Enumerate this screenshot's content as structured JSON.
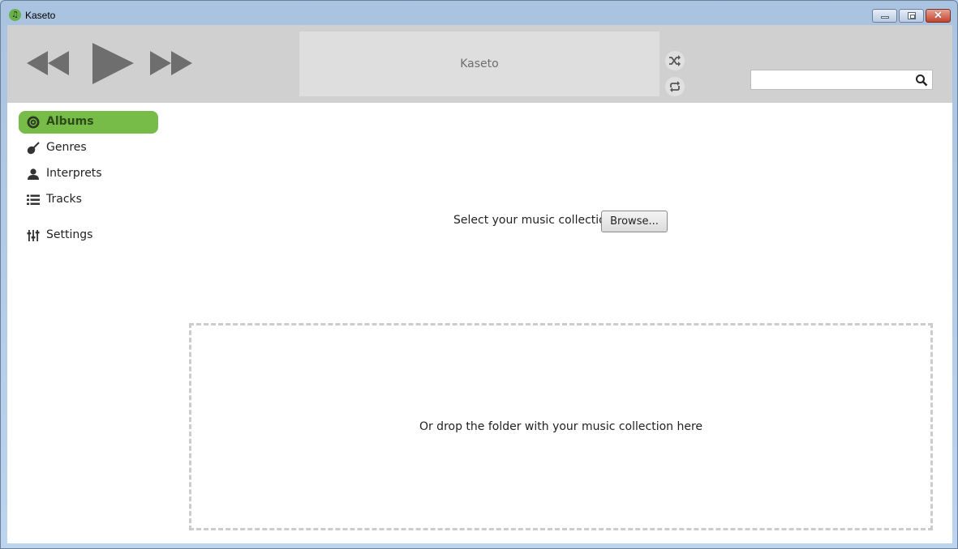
{
  "window": {
    "title": "Kaseto",
    "app_icon": "music-note-icon",
    "controls": {
      "minimize": "minimize-icon",
      "maximize": "restore-icon",
      "close": "close-icon",
      "close_glyph": "✕"
    }
  },
  "player": {
    "previous_icon": "rewind-icon",
    "play_icon": "play-icon",
    "next_icon": "fast-forward-icon",
    "now_playing": "Kaseto",
    "shuffle_icon": "shuffle-icon",
    "repeat_icon": "repeat-icon"
  },
  "search": {
    "value": "",
    "placeholder": "",
    "icon": "search-icon"
  },
  "sidebar": {
    "items": [
      {
        "label": "Albums",
        "icon": "disc-icon",
        "active": true
      },
      {
        "label": "Genres",
        "icon": "guitar-icon",
        "active": false
      },
      {
        "label": "Interprets",
        "icon": "person-icon",
        "active": false
      },
      {
        "label": "Tracks",
        "icon": "list-icon",
        "active": false
      },
      {
        "label": "Settings",
        "icon": "sliders-icon",
        "active": false
      }
    ]
  },
  "main": {
    "select_label": "Select your music collection:",
    "browse_label": "Browse...",
    "drop_text": "Or drop the folder with your music collection here"
  },
  "colors": {
    "accent": "#77bc48",
    "toolbar": "#d0d0d0",
    "now_playing_bg": "#dedede",
    "controls": "#6e6e6e"
  }
}
